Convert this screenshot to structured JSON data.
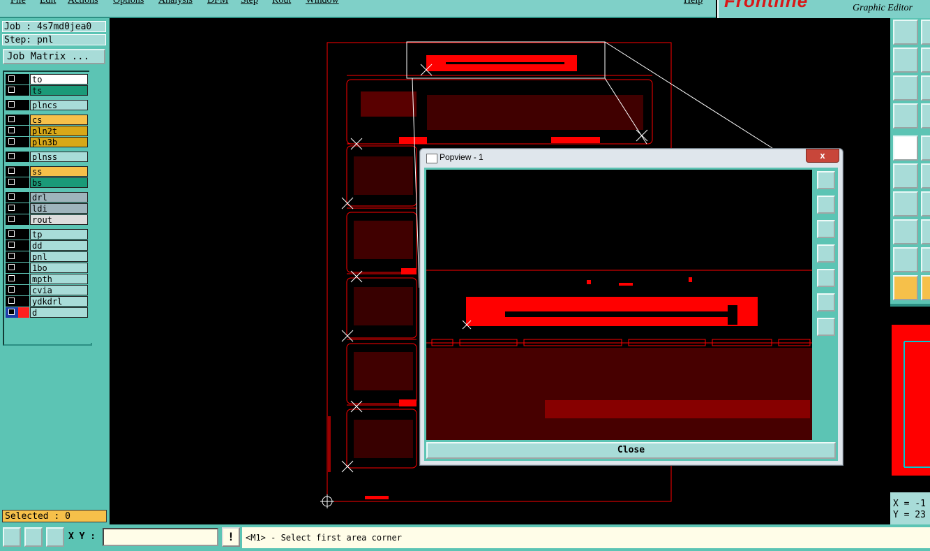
{
  "menu": {
    "items": [
      "File",
      "Edit",
      "Actions",
      "Options",
      "Analysis",
      "DFM",
      "Step",
      "Rout",
      "Window"
    ],
    "help": "Help"
  },
  "brand": {
    "logo": "Frontline",
    "subtitle": "Graphic Editor"
  },
  "job": {
    "job_label": "Job : 4s7md0jea0",
    "step_label": "Step: pnl",
    "matrix_button": "Job Matrix ..."
  },
  "layers": [
    {
      "name": "to",
      "color": "#ffffff"
    },
    {
      "name": "ts",
      "color": "#1a9a78"
    },
    {
      "name": "plncs",
      "color": "#a8dcd8"
    },
    {
      "name": "cs",
      "color": "#f6c04a"
    },
    {
      "name": "pln2t",
      "color": "#d8a818"
    },
    {
      "name": "pln3b",
      "color": "#d8a818"
    },
    {
      "name": "plnss",
      "color": "#a8dcd8"
    },
    {
      "name": "ss",
      "color": "#f6c04a"
    },
    {
      "name": "bs",
      "color": "#1a9a78"
    },
    {
      "name": "drl",
      "color": "#9eb4bc"
    },
    {
      "name": "ldi",
      "color": "#9eb4bc"
    },
    {
      "name": "rout",
      "color": "#dddddd"
    },
    {
      "name": "tp",
      "color": "#a8dcd8"
    },
    {
      "name": "dd",
      "color": "#a8dcd8"
    },
    {
      "name": "pnl",
      "color": "#a8dcd8"
    },
    {
      "name": "1bo",
      "color": "#a8dcd8"
    },
    {
      "name": "mpth",
      "color": "#a8dcd8"
    },
    {
      "name": "cvia",
      "color": "#a8dcd8"
    },
    {
      "name": "ydkdrl",
      "color": "#a8dcd8"
    },
    {
      "name": "d",
      "color": "#a8dcd8",
      "active": true,
      "swatch": "#ff2020"
    }
  ],
  "status": {
    "selected": "Selected : 0"
  },
  "bottom": {
    "xy_label": "X Y :",
    "xy_value": "",
    "bang": "!",
    "prompt": "<M1> - Select first area corner"
  },
  "coords": {
    "x": "X = -1",
    "y": "Y = 23"
  },
  "popview": {
    "title": "Popview - 1",
    "close_x": "x",
    "close_button": "Close"
  },
  "colors": {
    "panel": "#5cc4b4",
    "button": "#a8dcd8",
    "copper": "#ff0000",
    "canvas": "#000000"
  }
}
